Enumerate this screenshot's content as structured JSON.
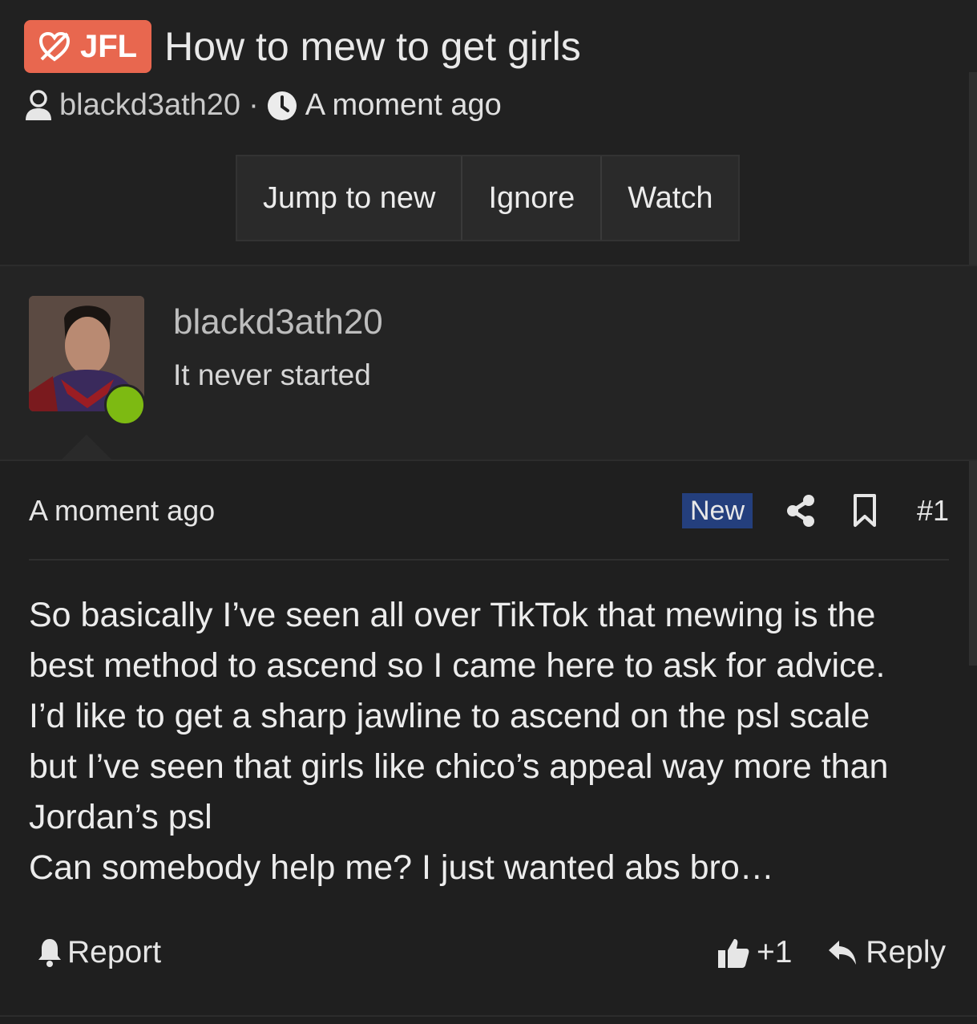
{
  "thread": {
    "prefix": "JFL",
    "title": "How to mew to get girls",
    "author": "blackd3ath20",
    "separator": "·",
    "time": "A moment ago"
  },
  "buttons": {
    "jump": "Jump to new",
    "ignore": "Ignore",
    "watch": "Watch"
  },
  "user": {
    "name": "blackd3ath20",
    "title": "It never started",
    "status": "online"
  },
  "post": {
    "time": "A moment ago",
    "badge": "New",
    "number": "#1",
    "lines": [
      "So basically I’ve seen all over TikTok that mewing is the",
      "best method to ascend so I came here to ask for advice.",
      "I’d like to get a sharp jawline to ascend on the psl scale",
      "but I’ve seen that girls like chico’s appeal way more than",
      "Jordan’s psl",
      "Can somebody help me? I just wanted abs bro…"
    ]
  },
  "actions": {
    "report": "Report",
    "like": "+1",
    "reply": "Reply"
  },
  "icons": {
    "prefix": "no-heart-icon",
    "author": "user-icon",
    "time": "clock-icon",
    "share": "share-icon",
    "bookmark": "bookmark-icon",
    "report": "bell-icon",
    "like": "thumbs-up-icon",
    "reply": "reply-icon"
  },
  "colors": {
    "background": "#1f1f1f",
    "prefix_bg": "#e8674f",
    "badge_bg": "#243f7d",
    "online": "#7dba12"
  }
}
